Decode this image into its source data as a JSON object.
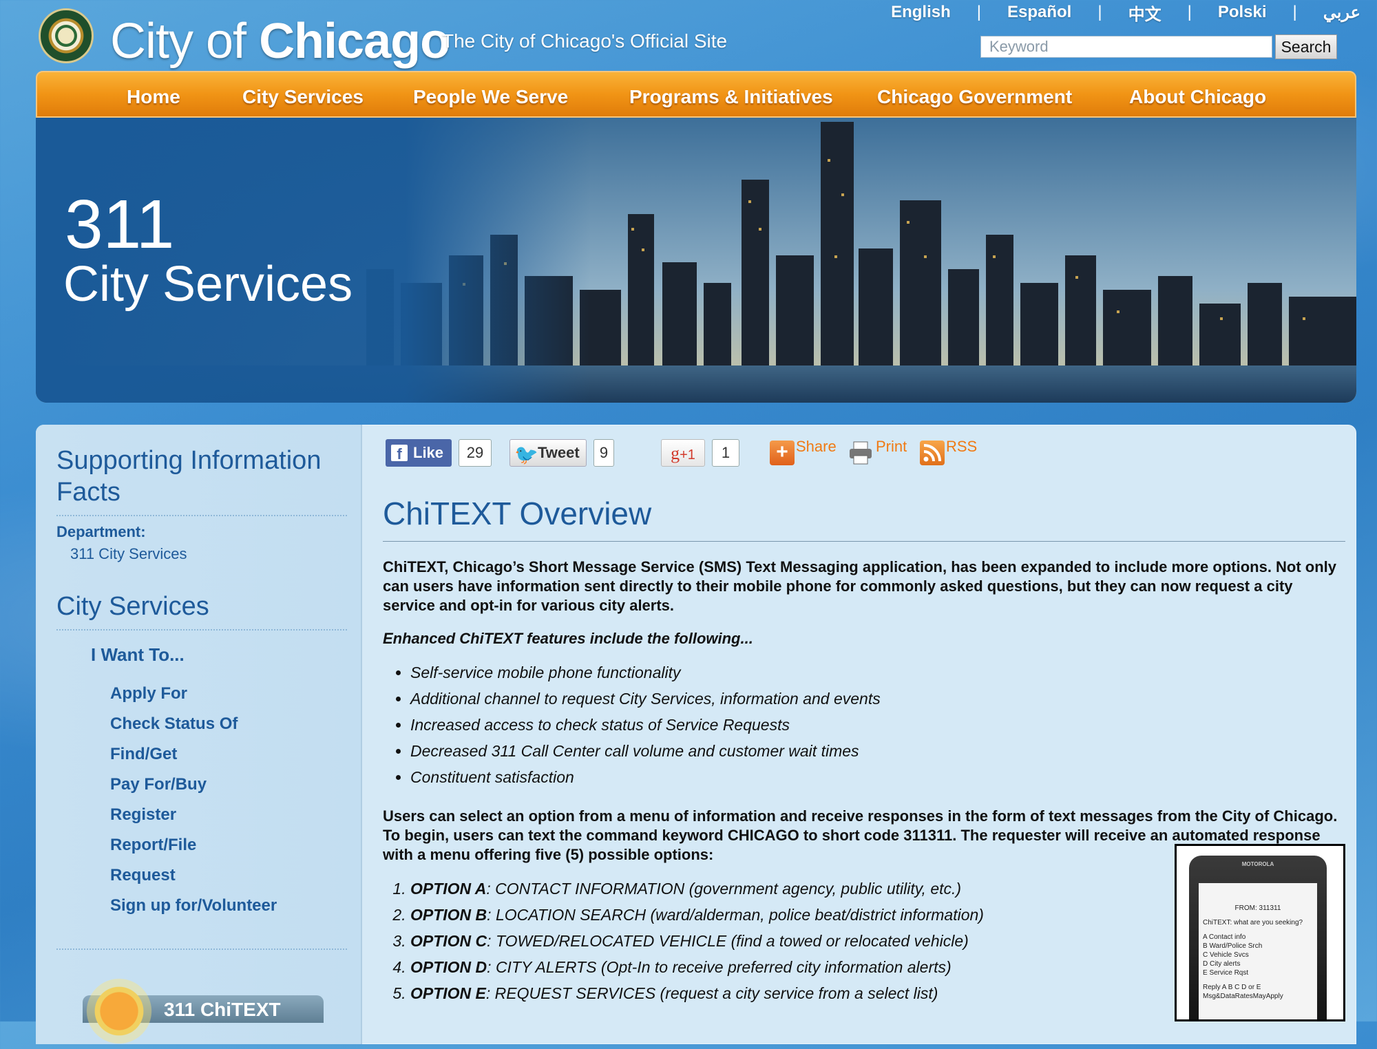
{
  "header": {
    "title_prefix": "City of ",
    "title_bold": "Chicago",
    "tagline": "The City of Chicago's Official Site",
    "languages": [
      "English",
      "Español",
      "中文",
      "Polski",
      "عربي"
    ],
    "search": {
      "placeholder": "Keyword",
      "button_label": "Search"
    }
  },
  "nav": {
    "items": [
      "Home",
      "City Services",
      "People We Serve",
      "Programs & Initiatives",
      "Chicago Government",
      "About Chicago"
    ]
  },
  "hero": {
    "line1": "311",
    "line2": "City Services"
  },
  "sidebar": {
    "heading1": "Supporting Information Facts",
    "department_label": "Department:",
    "department_value": "311 City Services",
    "heading2": "City Services",
    "subheading": "I Want To...",
    "links": [
      "Apply For",
      "Check Status Of",
      "Find/Get",
      "Pay For/Buy",
      "Register",
      "Report/File",
      "Request",
      "Sign up for/Volunteer"
    ],
    "badge_label": "311 ChiTEXT"
  },
  "social": {
    "like_label": "Like",
    "like_count": "29",
    "tweet_label": "Tweet",
    "tweet_count": "9",
    "gplus_label": "+1",
    "gplus_count": "1",
    "share_label": "Share",
    "print_label": "Print",
    "rss_label": "RSS"
  },
  "main": {
    "title": "ChiTEXT Overview",
    "intro": "ChiTEXT, Chicago’s Short Message Service (SMS) Text Messaging application, has been expanded to include more options. Not only can users have information sent directly to their mobile phone for commonly asked questions, but they can now request a city service and opt-in for various city alerts.",
    "features_heading": "Enhanced ChiTEXT features include the following...",
    "features": [
      "Self-service mobile phone functionality",
      "Additional channel to request City Services, information and events",
      "Increased access to check status of Service Requests",
      "Decreased 311 Call Center call volume and customer wait times",
      "Constituent satisfaction"
    ],
    "usage": "Users can select an option from a menu of information and receive responses in the form of text messages from the City of Chicago.  To begin, users can text the command keyword CHICAGO to short code 311311.  The requester will receive an automated response with a menu offering five (5) possible options:",
    "options": [
      {
        "key": "OPTION A",
        "text": ": CONTACT INFORMATION (government agency, public utility, etc.)"
      },
      {
        "key": "OPTION B",
        "text": ": LOCATION SEARCH (ward/alderman, police beat/district information)"
      },
      {
        "key": "OPTION C",
        "text": ": TOWED/RELOCATED VEHICLE (find a towed or relocated vehicle)"
      },
      {
        "key": "OPTION D",
        "text": ": CITY ALERTS (Opt-In to receive preferred city information alerts)"
      },
      {
        "key": "OPTION E",
        "text": ": REQUEST SERVICES (request a city service from a select list)"
      }
    ],
    "phone": {
      "brand": "MOTOROLA",
      "from": "FROM: 311311",
      "lines": [
        "ChiTEXT: what are you seeking?",
        "A Contact info",
        "B Ward/Police Srch",
        "C Vehicle Svcs",
        "D City alerts",
        "E Service Rqst",
        "Reply A B C D or E",
        "Msg&DataRatesMayApply"
      ]
    }
  },
  "colors": {
    "nav_orange": "#f19415",
    "link_blue": "#1e5a9a",
    "accent_orange": "#f07a14"
  }
}
